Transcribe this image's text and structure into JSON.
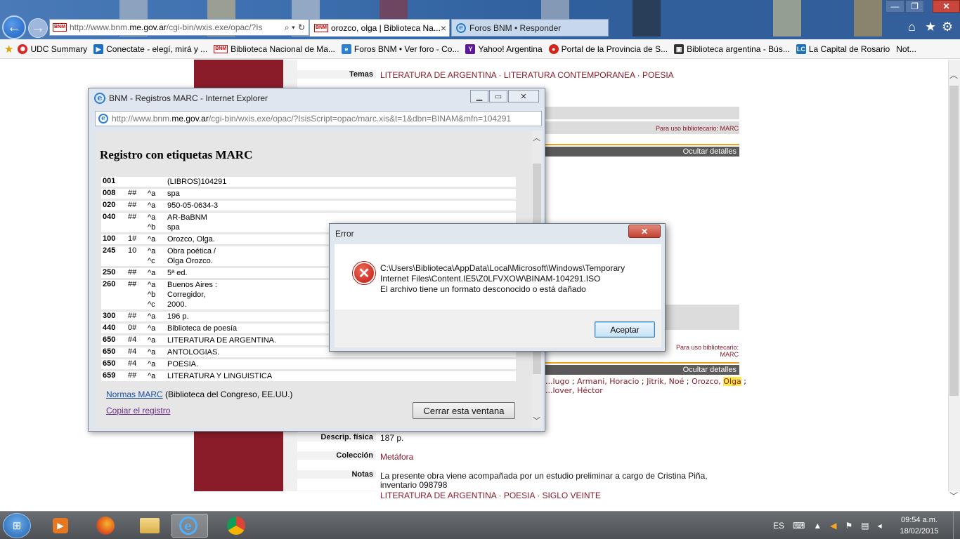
{
  "browser": {
    "address_url_host_pre": "http://www.bnm.",
    "address_url_host": "me.gov.ar",
    "address_url_path": "/cgi-bin/wxis.exe/opac/?Is",
    "tabs": [
      {
        "label": "orozco, olga | Biblioteca Na..."
      },
      {
        "label": "Foros BNM • Responder"
      }
    ],
    "close_glyph": "×",
    "window_controls": {
      "minimize": "—",
      "restore": "❐",
      "close": "✕"
    }
  },
  "favorites": [
    {
      "label": "UDC Summary",
      "icon": "udc-icon",
      "color": "#d22"
    },
    {
      "label": "Conectate - elegí, mirá y ...",
      "icon": "conectate-icon",
      "color": "#1b6fc6"
    },
    {
      "label": "Biblioteca Nacional de Ma...",
      "icon": "bnm-icon",
      "color": "#c00"
    },
    {
      "label": "Foros BNM • Ver foro - Co...",
      "icon": "ie-page-icon",
      "color": "#2a7fd4"
    },
    {
      "label": "Yahoo! Argentina",
      "icon": "yahoo-icon",
      "color": "#5c1a9b"
    },
    {
      "label": "Portal de la Provincia de S...",
      "icon": "portal-icon",
      "color": "#d4241a"
    },
    {
      "label": "Biblioteca argentina - Bús...",
      "icon": "biblioteca-icon",
      "color": "#333"
    },
    {
      "label": "La Capital de Rosario",
      "icon": "lacapital-icon",
      "color": "#1a6fbf"
    },
    {
      "label": "Not...",
      "icon": "",
      "color": ""
    }
  ],
  "page": {
    "temas_label": "Temas",
    "temas_top": [
      "LITERATURA DE ARGENTINA",
      "LITERATURA CONTEMPORANEA",
      "POESIA"
    ],
    "marc_link_text": "Para uso bibliotecario: MARC",
    "ocultar": "Ocultar detalles",
    "authors_line1": [
      "...lugo",
      "Armani, Horacio",
      "Jitrik, Noé",
      "Orozco,",
      "Olga"
    ],
    "authors_line2": "...lover, Héctor",
    "descrip_label": "Descrip. física",
    "descrip_value": "187 p.",
    "coleccion_label": "Colección",
    "coleccion_value": "Metáfora",
    "notas_label": "Notas",
    "notas_value_1": "La presente obra viene acompañada por un estudio preliminar a cargo de Cristina Piña,",
    "notas_value_2": "inventario 098798",
    "temas_bottom": [
      "LITERATURA DE ARGENTINA",
      "POESIA",
      "SIGLO VEINTE"
    ],
    "separator": " · "
  },
  "marc_window": {
    "title": "BNM - Registros MARC - Internet Explorer",
    "url_pre": "http://www.bnm.",
    "url_host": "me.gov.ar",
    "url_path": "/cgi-bin/wxis.exe/opac/?IsisScript=opac/marc.xis&t=1&dbn=BINAM&mfn=104291",
    "heading": "Registro con etiquetas MARC",
    "rows": [
      {
        "tag": "001",
        "ind": "",
        "subs": [
          {
            "code": "",
            "text": "(LIBROS)104291"
          }
        ]
      },
      {
        "tag": "008",
        "ind": "##",
        "subs": [
          {
            "code": "^a",
            "text": "spa"
          }
        ]
      },
      {
        "tag": "020",
        "ind": "##",
        "subs": [
          {
            "code": "^a",
            "text": "950-05-0634-3"
          }
        ]
      },
      {
        "tag": "040",
        "ind": "##",
        "subs": [
          {
            "code": "^a",
            "text": "AR-BaBNM"
          },
          {
            "code": "^b",
            "text": "spa"
          }
        ]
      },
      {
        "tag": "100",
        "ind": "1#",
        "subs": [
          {
            "code": "^a",
            "text": "Orozco, Olga."
          }
        ]
      },
      {
        "tag": "245",
        "ind": "10",
        "subs": [
          {
            "code": "^a",
            "text": "Obra poética /"
          },
          {
            "code": "^c",
            "text": "Olga Orozco."
          }
        ]
      },
      {
        "tag": "250",
        "ind": "##",
        "subs": [
          {
            "code": "^a",
            "text": "5ª ed."
          }
        ]
      },
      {
        "tag": "260",
        "ind": "##",
        "subs": [
          {
            "code": "^a",
            "text": "Buenos Aires :"
          },
          {
            "code": "^b",
            "text": "Corregidor,"
          },
          {
            "code": "^c",
            "text": "2000."
          }
        ]
      },
      {
        "tag": "300",
        "ind": "##",
        "subs": [
          {
            "code": "^a",
            "text": "196 p."
          }
        ]
      },
      {
        "tag": "440",
        "ind": "0#",
        "subs": [
          {
            "code": "^a",
            "text": "Biblioteca de poesía"
          }
        ]
      },
      {
        "tag": "650",
        "ind": "#4",
        "subs": [
          {
            "code": "^a",
            "text": "LITERATURA DE ARGENTINA."
          }
        ]
      },
      {
        "tag": "650",
        "ind": "#4",
        "subs": [
          {
            "code": "^a",
            "text": "ANTOLOGIAS."
          }
        ]
      },
      {
        "tag": "650",
        "ind": "#4",
        "subs": [
          {
            "code": "^a",
            "text": "POESIA."
          }
        ]
      },
      {
        "tag": "659",
        "ind": "##",
        "subs": [
          {
            "code": "^a",
            "text": "LITERATURA Y LINGUISTICA"
          }
        ]
      }
    ],
    "normas_link": "Normas MARC",
    "normas_suffix": " (Biblioteca del Congreso, EE.UU.)",
    "copiar_link": "Copiar el registro",
    "cerrar_button": "Cerrar esta ventana"
  },
  "error_dialog": {
    "title": "Error",
    "message_line1": "C:\\Users\\Biblioteca\\AppData\\Local\\Microsoft\\Windows\\Temporary",
    "message_line2": "Internet Files\\Content.IE5\\Z0LFVXOW\\BINAM-104291.ISO",
    "message_line3": "El archivo tiene un formato desconocido o está dañado",
    "ok_button": "Aceptar",
    "close_glyph": "✕",
    "icon_glyph": "✕"
  },
  "taskbar": {
    "language": "ES",
    "time": "09:54 a.m.",
    "date": "18/02/2015"
  }
}
